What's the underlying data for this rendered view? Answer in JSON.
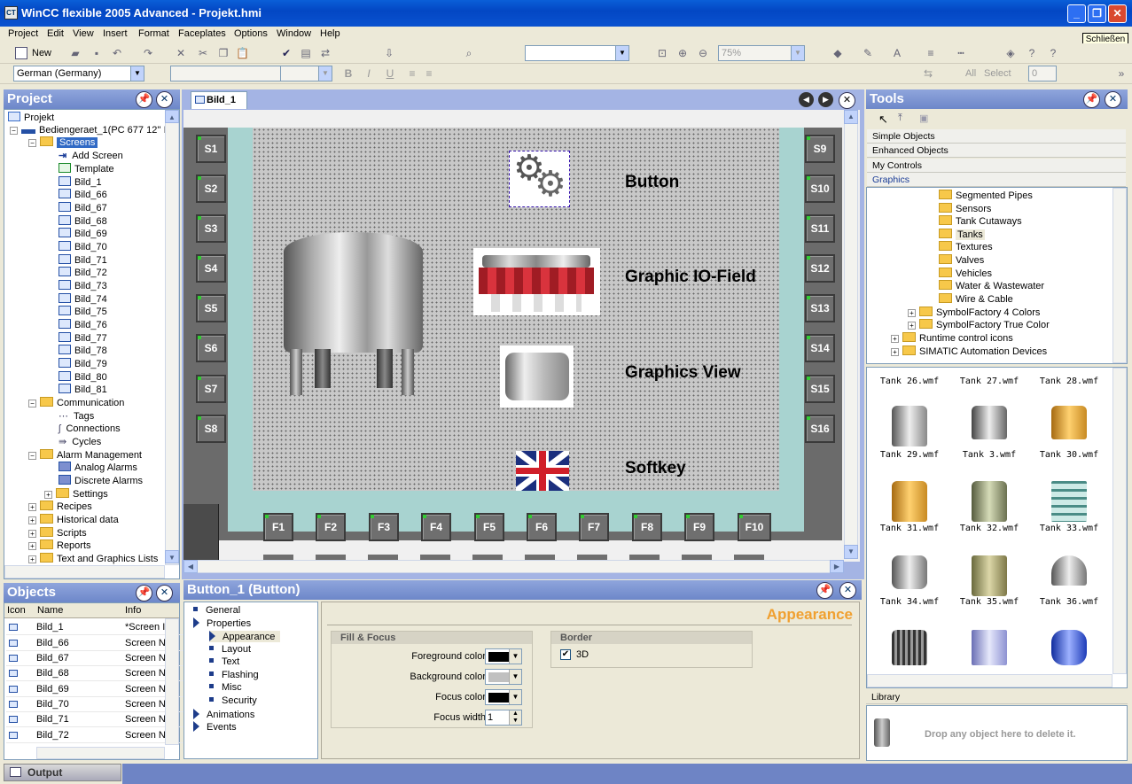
{
  "window": {
    "title": "WinCC flexible 2005 Advanced - Projekt.hmi",
    "close_tip": "Schließen"
  },
  "menu": [
    "Project",
    "Edit",
    "View",
    "Insert",
    "Format",
    "Faceplates",
    "Options",
    "Window",
    "Help"
  ],
  "toolbar": {
    "new_label": "New",
    "zoom": "75%",
    "language": "German (Germany)",
    "all_label": "All",
    "select_label": "Select",
    "spin_value": "0"
  },
  "project": {
    "title": "Project",
    "root": "Projekt",
    "device": "Bediengeraet_1(PC 677 12'' I",
    "screens_label": "Screens",
    "screens": [
      "Add Screen",
      "Template",
      "Bild_1",
      "Bild_66",
      "Bild_67",
      "Bild_68",
      "Bild_69",
      "Bild_70",
      "Bild_71",
      "Bild_72",
      "Bild_73",
      "Bild_74",
      "Bild_75",
      "Bild_76",
      "Bild_77",
      "Bild_78",
      "Bild_79",
      "Bild_80",
      "Bild_81"
    ],
    "communication": "Communication",
    "comm_items": [
      "Tags",
      "Connections",
      "Cycles"
    ],
    "alarm": "Alarm Management",
    "alarm_items": [
      "Analog Alarms",
      "Discrete Alarms",
      "Settings"
    ],
    "others": [
      "Recipes",
      "Historical data",
      "Scripts",
      "Reports",
      "Text and Graphics Lists"
    ]
  },
  "objects": {
    "title": "Objects",
    "headers": [
      "Icon",
      "Name",
      "Info"
    ],
    "rows": [
      {
        "name": "Bild_1",
        "info": "*Screen I"
      },
      {
        "name": "Bild_66",
        "info": "Screen N"
      },
      {
        "name": "Bild_67",
        "info": "Screen N"
      },
      {
        "name": "Bild_68",
        "info": "Screen N"
      },
      {
        "name": "Bild_69",
        "info": "Screen N"
      },
      {
        "name": "Bild_70",
        "info": "Screen N"
      },
      {
        "name": "Bild_71",
        "info": "Screen N"
      },
      {
        "name": "Bild_72",
        "info": "Screen N"
      }
    ]
  },
  "editor": {
    "tab": "Bild_1",
    "left_keys": [
      "S1",
      "S2",
      "S3",
      "S4",
      "S5",
      "S6",
      "S7",
      "S8"
    ],
    "right_keys": [
      "S9",
      "S10",
      "S11",
      "S12",
      "S13",
      "S14",
      "S15",
      "S16"
    ],
    "bottom_keys": [
      "F1",
      "F2",
      "F3",
      "F4",
      "F5",
      "F6",
      "F7",
      "F8",
      "F9",
      "F10"
    ],
    "labels": [
      "Button",
      "Graphic IO-Field",
      "Graphics View",
      "Softkey"
    ]
  },
  "tools": {
    "title": "Tools",
    "categories": [
      "Simple Objects",
      "Enhanced Objects",
      "My Controls",
      "Graphics"
    ],
    "tree": [
      "Segmented Pipes",
      "Sensors",
      "Tank Cutaways",
      "Tanks",
      "Textures",
      "Valves",
      "Vehicles",
      "Water & Wastewater",
      "Wire & Cable"
    ],
    "tree2": [
      "SymbolFactory 4 Colors",
      "SymbolFactory True Color",
      "Runtime control icons",
      "SIMATIC Automation Devices"
    ],
    "top_names": [
      "Tank 26.wmf",
      "Tank 27.wmf",
      "Tank 28.wmf"
    ],
    "tanks": [
      "Tank 29.wmf",
      "Tank 3.wmf",
      "Tank 30.wmf",
      "Tank 31.wmf",
      "Tank 32.wmf",
      "Tank 33.wmf",
      "Tank 34.wmf",
      "Tank 35.wmf",
      "Tank 36.wmf"
    ],
    "library_label": "Library",
    "drop_hint": "Drop any object here to delete it."
  },
  "properties": {
    "title": "Button_1 (Button)",
    "heading": "Appearance",
    "tree": [
      "General",
      "Properties",
      "Appearance",
      "Layout",
      "Text",
      "Flashing",
      "Misc",
      "Security",
      "Animations",
      "Events"
    ],
    "fill_group": "Fill & Focus",
    "fg_label": "Foreground color",
    "bg_label": "Background color",
    "focus_label": "Focus color",
    "focus_width_label": "Focus width",
    "focus_width": "1",
    "border_group": "Border",
    "border_3d": "3D",
    "colors": {
      "fg": "#000000",
      "bg": "#c0c0c0",
      "focus": "#000000"
    }
  },
  "output": {
    "label": "Output"
  }
}
